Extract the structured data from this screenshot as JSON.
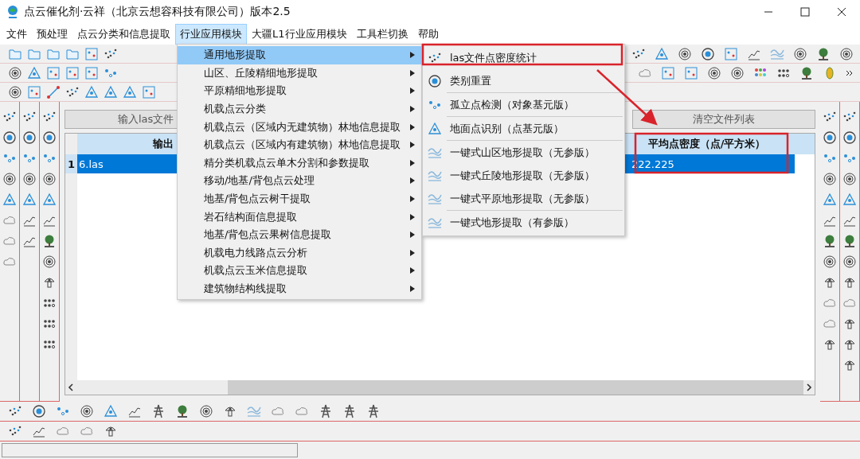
{
  "window": {
    "title": "点云催化剂·云祥（北京云想容科技有限公司）版本2.5"
  },
  "menu_bar": [
    {
      "label": "文件",
      "selected": false
    },
    {
      "label": "预处理",
      "selected": false
    },
    {
      "label": "点云分类和信息提取",
      "selected": false
    },
    {
      "label": "行业应用模块",
      "selected": true
    },
    {
      "label": "大疆L1行业应用模块",
      "selected": false
    },
    {
      "label": "工具栏切换",
      "selected": false
    },
    {
      "label": "帮助",
      "selected": false
    }
  ],
  "dropdown_menu": [
    {
      "label": "通用地形提取",
      "selected": true
    },
    {
      "label": "山区、丘陵精细地形提取",
      "selected": false
    },
    {
      "label": "平原精细地形提取",
      "selected": false
    },
    {
      "label": "机载点云分类",
      "selected": false
    },
    {
      "label": "机载点云（区域内无建筑物）林地信息提取",
      "selected": false
    },
    {
      "label": "机载点云（区域内有建筑物）林地信息提取",
      "selected": false
    },
    {
      "label": "精分类机载点云单木分割和参数提取",
      "selected": false
    },
    {
      "label": "移动/地基/背包点云处理",
      "selected": false
    },
    {
      "label": "地基/背包点云树干提取",
      "selected": false
    },
    {
      "label": "岩石结构面信息提取",
      "selected": false
    },
    {
      "label": "地基/背包点云果树信息提取",
      "selected": false
    },
    {
      "label": "机载电力线路点云分析",
      "selected": false
    },
    {
      "label": "机载点云玉米信息提取",
      "selected": false
    },
    {
      "label": "建筑物结构线提取",
      "selected": false
    }
  ],
  "submenu": [
    {
      "label": "las文件点密度统计",
      "kind": "scatter",
      "separator_after": false
    },
    {
      "label": "类别重置",
      "kind": "ring",
      "separator_after": true
    },
    {
      "label": "孤立点检测（对象基元版）",
      "kind": "dots",
      "separator_after": true
    },
    {
      "label": "地面点识别（点基元版）",
      "kind": "triangle",
      "separator_after": true
    },
    {
      "label": "一键式山区地形提取（无参版）",
      "kind": "terrain",
      "separator_after": false
    },
    {
      "label": "一键式丘陵地形提取（无参版）",
      "kind": "terrain",
      "separator_after": false
    },
    {
      "label": "一键式平原地形提取（无参版）",
      "kind": "terrain",
      "separator_after": true
    },
    {
      "label": "一键式地形提取（有参版）",
      "kind": "terrain",
      "separator_after": false
    }
  ],
  "buttons": [
    "输入las文件",
    "清空文件列表"
  ],
  "table": {
    "columns": [
      "输出",
      "平均点密度（点/平方米）"
    ],
    "rows": [
      {
        "number": "1",
        "cells": [
          "6.las",
          "222.225"
        ],
        "selected": true
      }
    ]
  }
}
